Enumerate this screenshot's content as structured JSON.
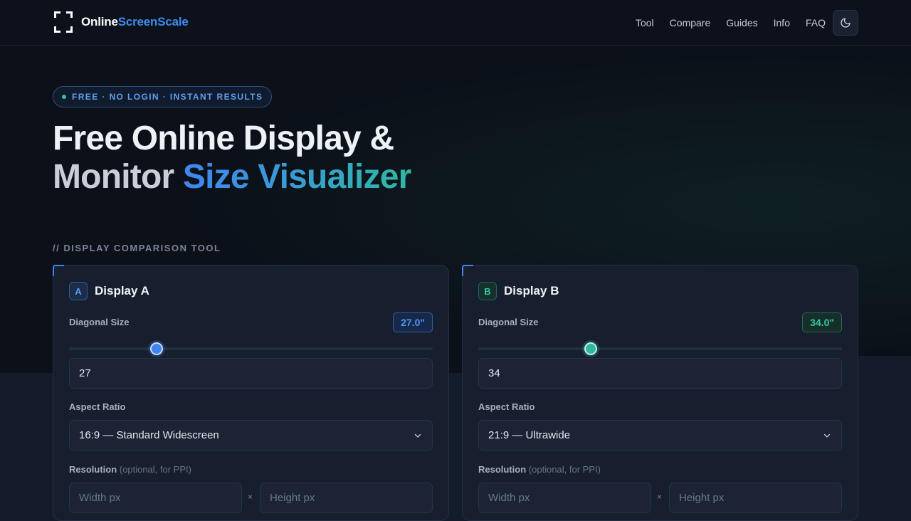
{
  "brand": {
    "part1": "Online",
    "part2": "ScreenScale"
  },
  "nav": [
    "Tool",
    "Compare",
    "Guides",
    "Info",
    "FAQ"
  ],
  "badge": "FREE · NO LOGIN · INSTANT RESULTS",
  "headline": {
    "line1": "Free Online Display &",
    "line2_plain": "Monitor ",
    "line2_highlight": "Size Visualizer"
  },
  "section_label": "// DISPLAY COMPARISON TOOL",
  "slider_range_hint": {
    "note": "slider position fraction"
  },
  "displays": [
    {
      "letter": "A",
      "title": "Display A",
      "diagonal_label": "Diagonal Size",
      "diagonal_badge": "27.0\"",
      "slider_fraction": 0.24,
      "diagonal_value": "27",
      "aspect_label": "Aspect Ratio",
      "aspect_value": "16:9 — Standard Widescreen",
      "resolution_label": "Resolution",
      "resolution_note": "(optional, for PPI)",
      "width_placeholder": "Width px",
      "height_placeholder": "Height px",
      "times": "×",
      "accent": "#3f86ee"
    },
    {
      "letter": "B",
      "title": "Display B",
      "diagonal_label": "Diagonal Size",
      "diagonal_badge": "34.0\"",
      "slider_fraction": 0.31,
      "diagonal_value": "34",
      "aspect_label": "Aspect Ratio",
      "aspect_value": "21:9 — Ultrawide",
      "resolution_label": "Resolution",
      "resolution_note": "(optional, for PPI)",
      "width_placeholder": "Width px",
      "height_placeholder": "Height px",
      "times": "×",
      "accent": "#2fb8a0"
    }
  ],
  "icons": {
    "theme_toggle": "moon-icon",
    "select": "chevron-down-icon",
    "logo": "screen-frame-icon"
  }
}
